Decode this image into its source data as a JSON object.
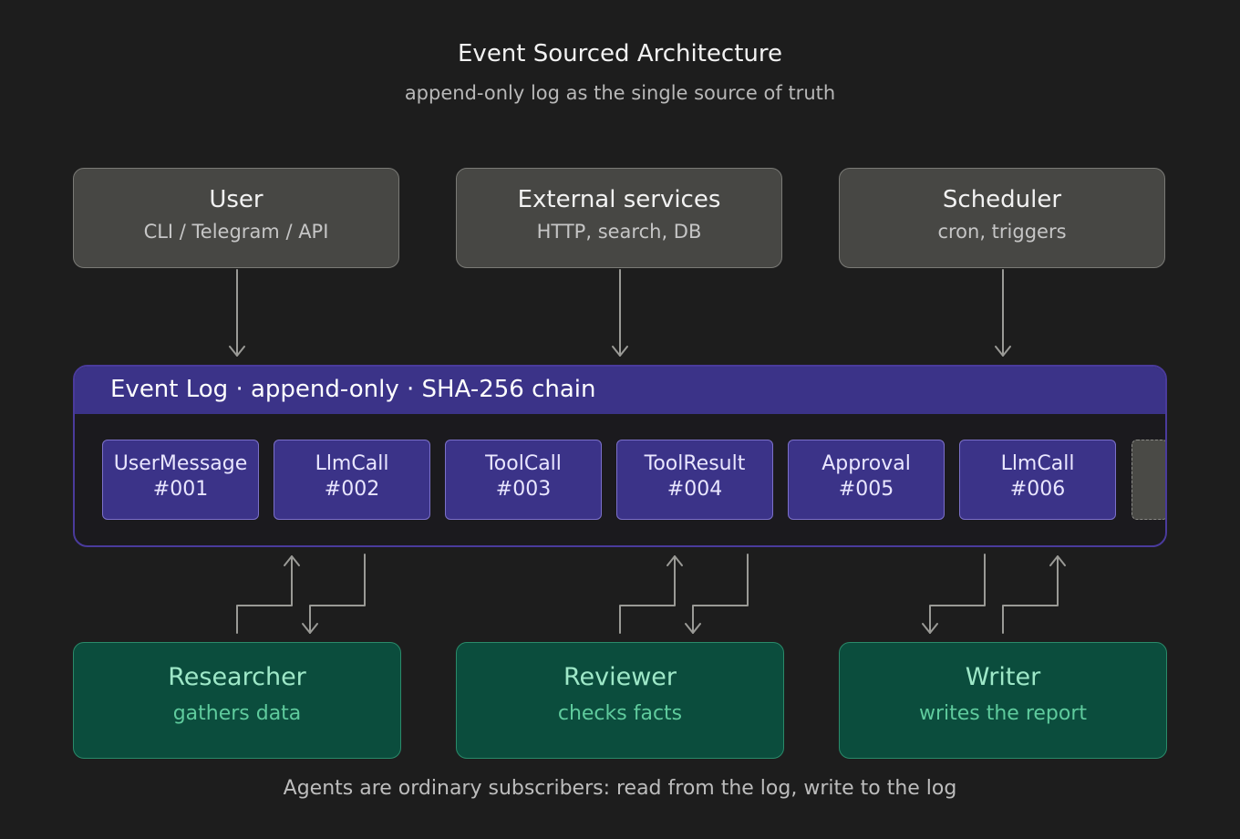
{
  "title": "Event Sourced Architecture",
  "subtitle": "append-only log as the single source of truth",
  "sources": [
    {
      "name": "User",
      "desc": "CLI / Telegram / API"
    },
    {
      "name": "External services",
      "desc": "HTTP, search, DB"
    },
    {
      "name": "Scheduler",
      "desc": "cron, triggers"
    }
  ],
  "event_log": {
    "title": "Event Log · append-only · SHA-256 chain",
    "events": [
      {
        "name": "UserMessage",
        "id": "#001"
      },
      {
        "name": "LlmCall",
        "id": "#002"
      },
      {
        "name": "ToolCall",
        "id": "#003"
      },
      {
        "name": "ToolResult",
        "id": "#004"
      },
      {
        "name": "Approval",
        "id": "#005"
      },
      {
        "name": "LlmCall",
        "id": "#006"
      }
    ]
  },
  "agents": [
    {
      "name": "Researcher",
      "desc": "gathers data"
    },
    {
      "name": "Reviewer",
      "desc": "checks facts"
    },
    {
      "name": "Writer",
      "desc": "writes the report"
    }
  ],
  "footer": "Agents are ordinary subscribers: read from the log, write to the log",
  "colors": {
    "background": "#1d1d1d",
    "source_box": "#474744",
    "log_accent": "#3b3388",
    "agent_box": "#0b4d3d",
    "agent_text": "#9ee8c8",
    "connector": "#9a9a96"
  }
}
